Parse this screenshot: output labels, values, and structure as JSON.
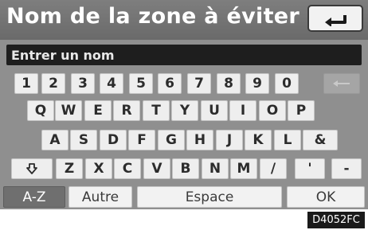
{
  "header": {
    "title": "Nom de la zone à éviter"
  },
  "input": {
    "placeholder": "Entrer un nom"
  },
  "keyboard": {
    "row1": [
      "1",
      "2",
      "3",
      "4",
      "5",
      "6",
      "7",
      "8",
      "9",
      "0"
    ],
    "row2": [
      "Q",
      "W",
      "E",
      "R",
      "T",
      "Y",
      "U",
      "I",
      "O",
      "P"
    ],
    "row3": [
      "A",
      "S",
      "D",
      "F",
      "G",
      "H",
      "J",
      "K",
      "L",
      "&"
    ],
    "row4": [
      "Z",
      "X",
      "C",
      "V",
      "B",
      "N",
      "M",
      "/",
      "'",
      "-"
    ]
  },
  "bottom_bar": {
    "az_label": "A-Z",
    "other_label": "Autre",
    "space_label": "Espace",
    "ok_label": "OK"
  },
  "figure_code": "D4052FC",
  "icons": {
    "back": "back-arrow-icon",
    "delete": "delete-arrow-icon",
    "shift": "shift-arrow-icon"
  }
}
